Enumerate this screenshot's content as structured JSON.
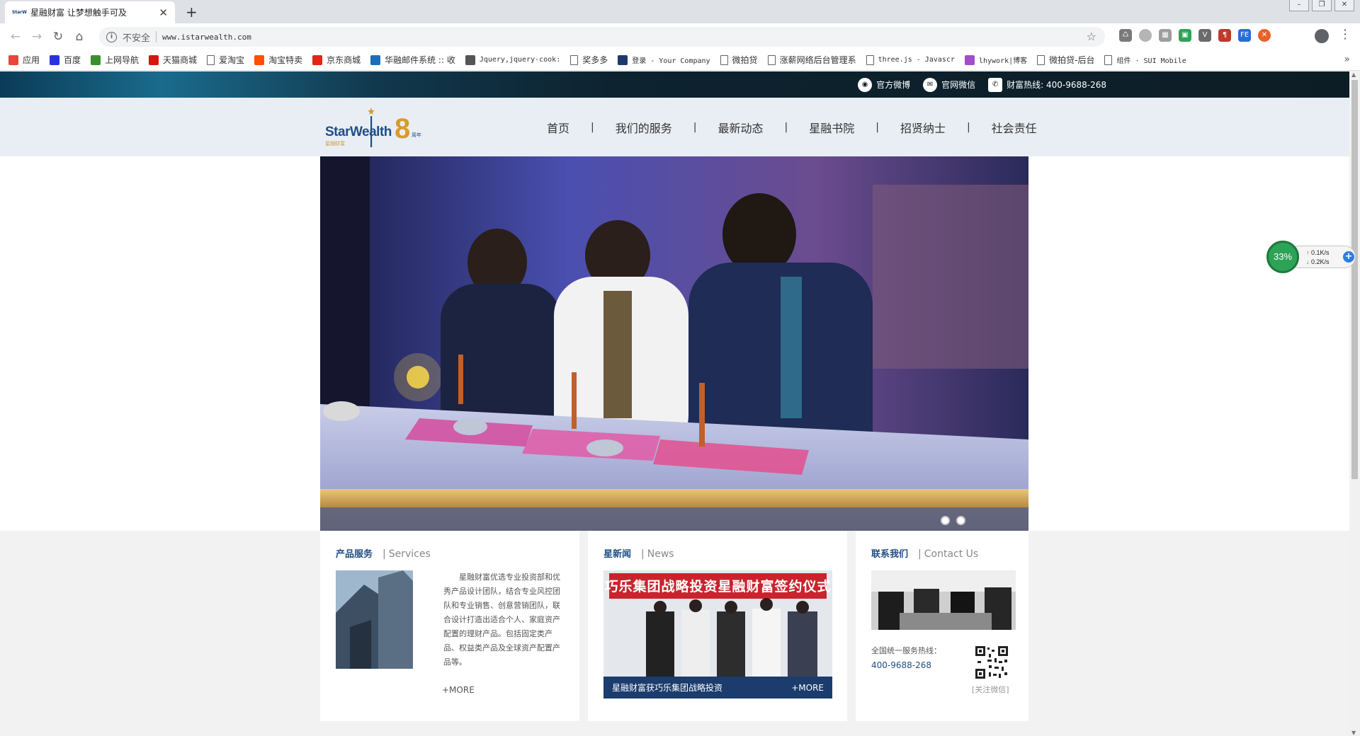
{
  "browser": {
    "tab_title": "星融财富 让梦想触手可及",
    "tab_favicon_text": "StarW",
    "address_security": "不安全",
    "address_url": "www.istarwealth.com",
    "bookmarks": [
      {
        "label": "应用",
        "icon": "apps-grid-icon",
        "color": "#e8453c"
      },
      {
        "label": "百度",
        "icon": "baidu-paw-icon",
        "color": "#2932e1"
      },
      {
        "label": "上网导航",
        "icon": "hao123-icon",
        "color": "#3a8f2f"
      },
      {
        "label": "天猫商城",
        "icon": "tmall-icon",
        "color": "#d8140f"
      },
      {
        "label": "爱淘宝",
        "icon": "doc-icon",
        "color": ""
      },
      {
        "label": "淘宝特卖",
        "icon": "taobao-icon",
        "color": "#ff5000"
      },
      {
        "label": "京东商城",
        "icon": "jd-icon",
        "color": "#e1251b"
      },
      {
        "label": "华融邮件系统 :: 收",
        "icon": "mail-icon",
        "color": "#1c6fb7"
      },
      {
        "label": "Jquery,jquery-cook:",
        "icon": "jquery-icon",
        "color": "#555555"
      },
      {
        "label": "奖多多",
        "icon": "doc-icon",
        "color": ""
      },
      {
        "label": "登录 - Your Company",
        "icon": "login-icon",
        "color": "#1a3a6b"
      },
      {
        "label": "微拍贷",
        "icon": "doc-icon",
        "color": ""
      },
      {
        "label": "涨薪网络后台管理系",
        "icon": "doc-icon",
        "color": ""
      },
      {
        "label": "three.js - Javascr",
        "icon": "doc-icon",
        "color": ""
      },
      {
        "label": "lhywork|博客",
        "icon": "feather-icon",
        "color": "#a04fc8"
      },
      {
        "label": "微拍贷-后台",
        "icon": "doc-icon",
        "color": ""
      },
      {
        "label": "组件 · SUI Mobile",
        "icon": "doc-icon",
        "color": ""
      }
    ],
    "bookmarks_overflow": "»"
  },
  "site": {
    "topbar": {
      "weibo": "官方微博",
      "wechat": "官网微信",
      "hotline": "财富热线: 400-9688-268"
    },
    "logo": {
      "brand": "StarWealth",
      "sub": "星融财富",
      "eight": "8",
      "years": "周年"
    },
    "nav": [
      "首页",
      "我们的服务",
      "最新动态",
      "星融书院",
      "招贤纳士",
      "社会责任"
    ],
    "nav_separator": "|",
    "cards": {
      "services": {
        "title_cn": "产品服务",
        "title_en": "Services",
        "text": "星融财富优选专业投资部和优秀产品设计团队，结合专业风控团队和专业销售、创意营销团队，联合设计打造出适合个人、家庭资产配置的理财产品。包括固定类产品、权益类产品及全球资产配置产品等。",
        "more": "+MORE"
      },
      "news": {
        "title_cn": "星新闻",
        "title_en": "News",
        "image_banner": "巧乐集团战略投资星融财富签约仪式",
        "caption": "星融财富获巧乐集团战略投资",
        "more": "+MORE"
      },
      "contact": {
        "title_cn": "联系我们",
        "title_en": "Contact Us",
        "hotline_label": "全国统一服务热线：",
        "hotline_number": "400-9688-268",
        "qr_label": "[关注微信]"
      }
    }
  },
  "net_monitor": {
    "percent": "33%",
    "up": "0.1K/s",
    "down": "0.2K/s"
  },
  "colors": {
    "brand_blue": "#1f4e86",
    "news_bar": "#1b3c6d",
    "gold": "#d99a2b"
  }
}
